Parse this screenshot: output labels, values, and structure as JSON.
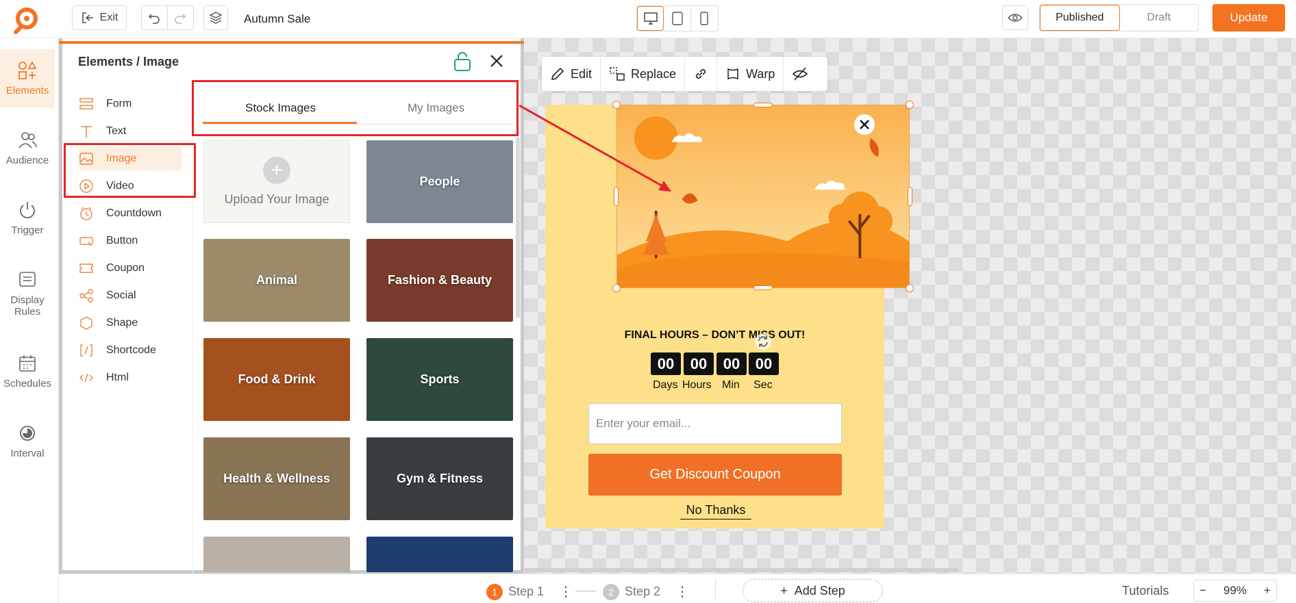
{
  "topbar": {
    "exit_label": "Exit",
    "campaign_title": "Autumn Sale",
    "status_published": "Published",
    "status_draft": "Draft",
    "update_label": "Update"
  },
  "rail": [
    {
      "label": "Elements",
      "icon": "shapes-icon",
      "active": true
    },
    {
      "label": "Audience",
      "icon": "users-icon"
    },
    {
      "label": "Trigger",
      "icon": "power-icon"
    },
    {
      "label": "Display Rules",
      "icon": "monitor-rules-icon"
    },
    {
      "label": "Schedules",
      "icon": "calendar-icon"
    },
    {
      "label": "Interval",
      "icon": "interval-icon"
    }
  ],
  "panel": {
    "title": "Elements / Image",
    "elements": [
      {
        "label": "Form",
        "icon": "form-icon"
      },
      {
        "label": "Text",
        "icon": "text-icon"
      },
      {
        "label": "Image",
        "icon": "image-icon",
        "active": true
      },
      {
        "label": "Video",
        "icon": "video-icon"
      },
      {
        "label": "Countdown",
        "icon": "clock-icon"
      },
      {
        "label": "Button",
        "icon": "button-icon"
      },
      {
        "label": "Coupon",
        "icon": "coupon-icon"
      },
      {
        "label": "Social",
        "icon": "share-icon"
      },
      {
        "label": "Shape",
        "icon": "hexagon-icon"
      },
      {
        "label": "Shortcode",
        "icon": "shortcode-icon"
      },
      {
        "label": "Html",
        "icon": "code-icon"
      }
    ],
    "tabs": {
      "stock": "Stock Images",
      "mine": "My Images"
    },
    "upload_label": "Upload Your Image",
    "categories": [
      {
        "label": "People",
        "color": "#7d8794"
      },
      {
        "label": "Animal",
        "color": "#9c8a6b"
      },
      {
        "label": "Fashion & Beauty",
        "color": "#7a3a2c"
      },
      {
        "label": "Food & Drink",
        "color": "#a5501f"
      },
      {
        "label": "Sports",
        "color": "#2f4a3a"
      },
      {
        "label": "Health & Wellness",
        "color": "#8a7456"
      },
      {
        "label": "Gym & Fitness",
        "color": "#3a3d40"
      }
    ]
  },
  "toolbar": {
    "edit": "Edit",
    "replace": "Replace",
    "warp": "Warp"
  },
  "popup": {
    "headline": "FINAL HOURS – DON’T MISS OUT!",
    "countdown": [
      {
        "value": "00",
        "label": "Days"
      },
      {
        "value": "00",
        "label": "Hours"
      },
      {
        "value": "00",
        "label": "Min"
      },
      {
        "value": "00",
        "label": "Sec"
      }
    ],
    "email_placeholder": "Enter your email...",
    "cta_label": "Get Discount Coupon",
    "dismiss_label": "No Thanks"
  },
  "bottombar": {
    "steps": [
      {
        "num": "1",
        "label": "Step 1",
        "active": true
      },
      {
        "num": "2",
        "label": "Step 2"
      }
    ],
    "add_step_label": "Add Step",
    "tutorials_label": "Tutorials",
    "zoom_level": "99%"
  },
  "colors": {
    "accent": "#f47321",
    "popup_bg": "#fde089",
    "annotation_red": "#e5252a"
  }
}
